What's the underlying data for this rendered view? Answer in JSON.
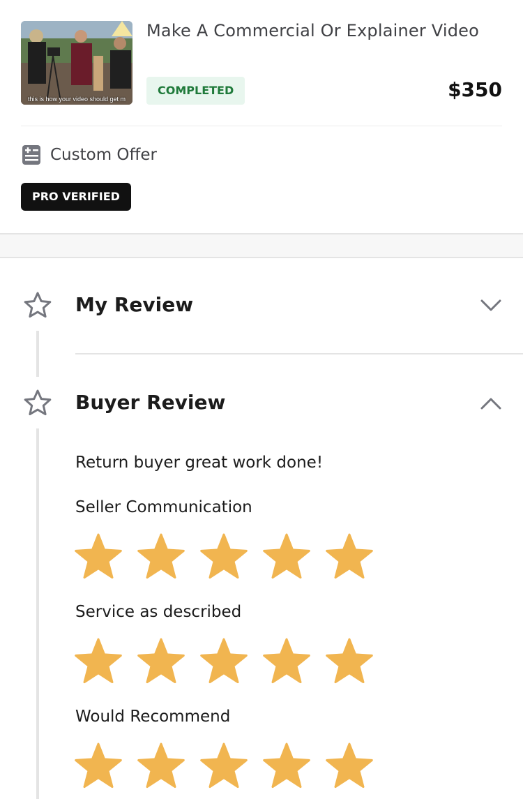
{
  "order": {
    "thumbnail_caption": "this is how your video should get m",
    "title": "Make A Commercial Or Explainer Video",
    "status": "COMPLETED",
    "price": "$350",
    "offer_type": "Custom Offer",
    "badge": "PRO VERIFIED"
  },
  "sections": {
    "my_review": {
      "title": "My Review",
      "expanded": false
    },
    "buyer_review": {
      "title": "Buyer Review",
      "expanded": true
    }
  },
  "buyer_review": {
    "text": "Return buyer great work done!",
    "ratings": [
      {
        "label": "Seller Communication",
        "stars": 5,
        "max": 5
      },
      {
        "label": "Service as described",
        "stars": 5,
        "max": 5
      },
      {
        "label": "Would Recommend",
        "stars": 5,
        "max": 5
      }
    ]
  },
  "colors": {
    "star_fill": "#f1b550",
    "status_bg": "#e8f6ee",
    "status_text": "#1f7a3a",
    "badge_bg": "#111111",
    "icon_gray": "#74767e"
  },
  "icons": {
    "offer": "offer-list-icon",
    "section": "star-outline-icon",
    "collapse": "chevron-down-icon",
    "expand": "chevron-up-icon",
    "rating": "star-filled-icon"
  }
}
